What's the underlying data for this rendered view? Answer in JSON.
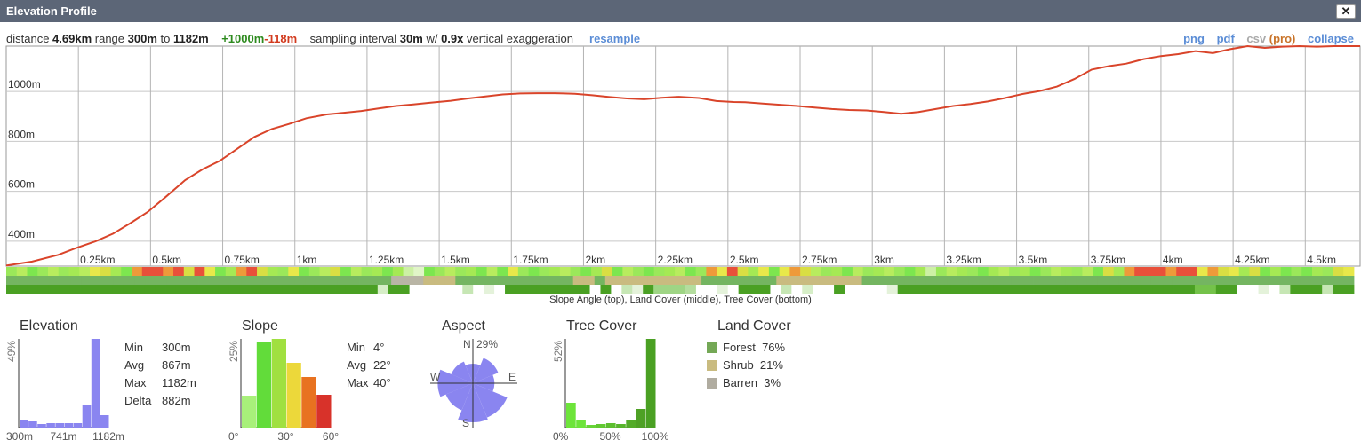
{
  "window": {
    "title": "Elevation Profile",
    "close_label": "✕"
  },
  "info": {
    "distance_label": "distance",
    "distance": "4.69km",
    "range_label": "range",
    "range_min": "300m",
    "to_label": "to",
    "range_max": "1182m",
    "gain": "+1000m",
    "loss": "-118m",
    "sampling_label": "sampling interval",
    "sampling": "30m",
    "w_label": "w/",
    "exaggeration": "0.9x",
    "exaggeration_label": "vertical exaggeration",
    "resample": "resample"
  },
  "toolbar": {
    "png": "png",
    "pdf": "pdf",
    "csv": "csv",
    "pro": "(pro)",
    "collapse": "collapse"
  },
  "chart_data": {
    "type": "line",
    "x_unit": "km",
    "y_unit": "m",
    "xlim": [
      0,
      4.69
    ],
    "ylim": [
      300,
      1182
    ],
    "y_ticks": [
      {
        "value": 400,
        "label": "400m"
      },
      {
        "value": 600,
        "label": "600m"
      },
      {
        "value": 800,
        "label": "800m"
      },
      {
        "value": 1000,
        "label": "1000m"
      }
    ],
    "x_ticks": [
      {
        "value": 0.25,
        "label": "0.25km"
      },
      {
        "value": 0.5,
        "label": "0.5km"
      },
      {
        "value": 0.75,
        "label": "0.75km"
      },
      {
        "value": 1.0,
        "label": "1km"
      },
      {
        "value": 1.25,
        "label": "1.25km"
      },
      {
        "value": 1.5,
        "label": "1.5km"
      },
      {
        "value": 1.75,
        "label": "1.75km"
      },
      {
        "value": 2.0,
        "label": "2km"
      },
      {
        "value": 2.25,
        "label": "2.25km"
      },
      {
        "value": 2.5,
        "label": "2.5km"
      },
      {
        "value": 2.75,
        "label": "2.75km"
      },
      {
        "value": 3.0,
        "label": "3km"
      },
      {
        "value": 3.25,
        "label": "3.25km"
      },
      {
        "value": 3.5,
        "label": "3.5km"
      },
      {
        "value": 3.75,
        "label": "3.75km"
      },
      {
        "value": 4.0,
        "label": "4km"
      },
      {
        "value": 4.25,
        "label": "4.25km"
      },
      {
        "value": 4.5,
        "label": "4.5km"
      }
    ],
    "series": [
      {
        "color": "#d9442a",
        "x": [
          0,
          0.09,
          0.18,
          0.24,
          0.31,
          0.37,
          0.43,
          0.49,
          0.55,
          0.62,
          0.68,
          0.74,
          0.8,
          0.86,
          0.92,
          0.98,
          1.04,
          1.11,
          1.17,
          1.23,
          1.29,
          1.35,
          1.41,
          1.47,
          1.54,
          1.6,
          1.66,
          1.72,
          1.78,
          1.84,
          1.9,
          1.97,
          2.03,
          2.09,
          2.15,
          2.21,
          2.27,
          2.33,
          2.4,
          2.46,
          2.52,
          2.56,
          2.62,
          2.68,
          2.74,
          2.8,
          2.86,
          2.92,
          2.98,
          3.04,
          3.1,
          3.16,
          3.22,
          3.28,
          3.34,
          3.4,
          3.46,
          3.52,
          3.58,
          3.64,
          3.7,
          3.76,
          3.82,
          3.88,
          3.94,
          4.0,
          4.06,
          4.12,
          4.18,
          4.24,
          4.3,
          4.36,
          4.42,
          4.48,
          4.54,
          4.6,
          4.69
        ],
        "y": [
          302,
          318,
          345,
          372,
          400,
          430,
          472,
          517,
          575,
          645,
          688,
          722,
          770,
          818,
          850,
          870,
          893,
          908,
          915,
          922,
          932,
          942,
          948,
          955,
          963,
          972,
          980,
          988,
          992,
          993,
          993,
          991,
          985,
          978,
          972,
          969,
          975,
          979,
          974,
          962,
          958,
          957,
          952,
          947,
          942,
          936,
          930,
          926,
          924,
          918,
          911,
          918,
          930,
          942,
          950,
          960,
          974,
          990,
          1002,
          1020,
          1050,
          1088,
          1102,
          1112,
          1130,
          1142,
          1150,
          1162,
          1154,
          1170,
          1182,
          1175,
          1180,
          1182,
          1180,
          1182,
          1182
        ]
      }
    ],
    "bands": [
      {
        "name": "Slope Angle",
        "colors": [
          "#9be85a",
          "#b8ec5e",
          "#7de64f",
          "#9be85a",
          "#b8ec5e",
          "#9be85a",
          "#a5e954",
          "#b8ec5e",
          "#e8e84a",
          "#d9de43",
          "#a5e954",
          "#7de64f",
          "#ee9a3a",
          "#e8503a",
          "#e8503a",
          "#ee9a3a",
          "#e8503a",
          "#d9de43",
          "#e8503a",
          "#e8e84a",
          "#7de64f",
          "#a5e954",
          "#ee9a3a",
          "#e8503a",
          "#d9de43",
          "#a5e954",
          "#9be85a",
          "#e8e84a",
          "#7de64f",
          "#9be85a",
          "#b8ec5e",
          "#d9de43",
          "#7de64f",
          "#b8ec5e",
          "#9be85a",
          "#a5e954",
          "#7de64f",
          "#a5e954",
          "#cdf0a5",
          "#e1f5c8",
          "#7de64f",
          "#9be85a",
          "#b8ec5e",
          "#9be85a",
          "#a5e954",
          "#7de64f",
          "#b8ec5e",
          "#7de64f",
          "#e8e84a",
          "#9be85a",
          "#7de64f",
          "#9be85a",
          "#a5e954",
          "#b8ec5e",
          "#9be85a",
          "#7de64f",
          "#a5e954",
          "#d9de43",
          "#7de64f",
          "#b8ec5e",
          "#9be85a",
          "#7de64f",
          "#9be85a",
          "#a5e954",
          "#b8ec5e",
          "#7de64f",
          "#9be85a",
          "#ee9a3a",
          "#e8e84a",
          "#e8503a",
          "#d9de43",
          "#a5e954",
          "#e8e84a",
          "#7de64f",
          "#e8e84a",
          "#ee9a3a",
          "#d9de43",
          "#b8ec5e",
          "#9be85a",
          "#a5e954",
          "#7de64f",
          "#b8ec5e",
          "#9be85a",
          "#a5e954",
          "#b8ec5e",
          "#9be85a",
          "#7de64f",
          "#a5e954",
          "#cdf0a5",
          "#9be85a",
          "#b8ec5e",
          "#a5e954",
          "#9be85a",
          "#7de64f",
          "#a5e954",
          "#b8ec5e",
          "#9be85a",
          "#a5e954",
          "#7de64f",
          "#9be85a",
          "#b8ec5e",
          "#a5e954",
          "#9be85a",
          "#b8ec5e",
          "#7de64f",
          "#d9de43",
          "#a5e954",
          "#ee9a3a",
          "#e8503a",
          "#e8503a",
          "#e8503a",
          "#ee9a3a",
          "#e8503a",
          "#e8503a",
          "#e8e84a",
          "#ee9a3a",
          "#d9de43",
          "#e8e84a",
          "#a5e954",
          "#d9de43",
          "#7de64f",
          "#a5e954",
          "#7de64f",
          "#9be85a",
          "#7de64f",
          "#a5e954",
          "#9be85a",
          "#d9de43",
          "#e8e84a"
        ]
      },
      {
        "name": "Land Cover",
        "colors": [
          "#74b561",
          "#74b561",
          "#74b561",
          "#74b561",
          "#74b561",
          "#74b561",
          "#74b561",
          "#74b561",
          "#74b561",
          "#74b561",
          "#74b561",
          "#74b561",
          "#74b561",
          "#74b561",
          "#74b561",
          "#74b561",
          "#74b561",
          "#74b561",
          "#74b561",
          "#74b561",
          "#74b561",
          "#74b561",
          "#74b561",
          "#74b561",
          "#74b561",
          "#74b561",
          "#74b561",
          "#74b561",
          "#74b561",
          "#74b561",
          "#74b561",
          "#74b561",
          "#74b561",
          "#74b561",
          "#74b561",
          "#74b561",
          "#b9b5a5",
          "#b9b5a5",
          "#b9b5a5",
          "#c9bb80",
          "#c9bb80",
          "#c9bb80",
          "#74b561",
          "#74b561",
          "#74b561",
          "#74b561",
          "#74b561",
          "#74b561",
          "#74b561",
          "#74b561",
          "#74b561",
          "#74b561",
          "#74b561",
          "#c9bb80",
          "#c9bb80",
          "#74b561",
          "#c9bb80",
          "#c9bb80",
          "#c9bb80",
          "#c9bb80",
          "#c9bb80",
          "#c9bb80",
          "#c9bb80",
          "#c9bb80",
          "#c9bb80",
          "#74b561",
          "#74b561",
          "#74b561",
          "#74b561",
          "#74b561",
          "#74b561",
          "#74b561",
          "#c9bb80",
          "#c9bb80",
          "#c9bb80",
          "#c9bb80",
          "#c9bb80",
          "#c9bb80",
          "#c9bb80",
          "#c9bb80",
          "#74b561",
          "#74b561",
          "#74b561",
          "#74b561",
          "#74b561",
          "#74b561",
          "#74b561",
          "#74b561",
          "#74b561",
          "#74b561",
          "#74b561",
          "#74b561",
          "#74b561",
          "#74b561",
          "#74b561",
          "#74b561",
          "#74b561",
          "#74b561",
          "#74b561",
          "#74b561",
          "#74b561",
          "#74b561",
          "#74b561",
          "#74b561",
          "#74b561",
          "#74b561",
          "#74b561",
          "#74b561",
          "#74b561",
          "#74b561",
          "#74b561",
          "#74b561",
          "#74b561",
          "#74b561",
          "#74b561",
          "#74b561",
          "#74b561",
          "#74b561",
          "#74b561",
          "#74b561",
          "#74b561",
          "#74b561",
          "#74b561",
          "#74b561",
          "#74b561",
          "#74b561"
        ]
      },
      {
        "name": "Tree Cover",
        "colors": [
          "#4aa023",
          "#4aa023",
          "#4aa023",
          "#4aa023",
          "#4aa023",
          "#4aa023",
          "#4aa023",
          "#4aa023",
          "#4aa023",
          "#4aa023",
          "#4aa023",
          "#4aa023",
          "#4aa023",
          "#4aa023",
          "#4aa023",
          "#4aa023",
          "#4aa023",
          "#4aa023",
          "#4aa023",
          "#4aa023",
          "#4aa023",
          "#4aa023",
          "#4aa023",
          "#4aa023",
          "#4aa023",
          "#4aa023",
          "#4aa023",
          "#4aa023",
          "#4aa023",
          "#4aa023",
          "#4aa023",
          "#4aa023",
          "#4aa023",
          "#4aa023",
          "#4aa023",
          "#d6eec7",
          "#4aa023",
          "#4aa023",
          "#ffffff",
          "#ffffff",
          "#ffffff",
          "#ffffff",
          "#ffffff",
          "#c6e6b4",
          "#ffffff",
          "#e4f2da",
          "#ffffff",
          "#4aa023",
          "#4aa023",
          "#4aa023",
          "#4aa023",
          "#4aa023",
          "#4aa023",
          "#4aa023",
          "#4aa023",
          "#ffffff",
          "#4aa023",
          "#ffffff",
          "#c6e6b4",
          "#e4f2da",
          "#4aa023",
          "#9fd585",
          "#9fd585",
          "#9fd585",
          "#b4dd9e",
          "#ffffff",
          "#ffffff",
          "#e4f2da",
          "#ffffff",
          "#4aa023",
          "#4aa023",
          "#4aa023",
          "#ffffff",
          "#c6e6b4",
          "#ffffff",
          "#d6eec7",
          "#ffffff",
          "#ffffff",
          "#4aa023",
          "#ffffff",
          "#ffffff",
          "#ffffff",
          "#ffffff",
          "#e4f2da",
          "#4aa023",
          "#4aa023",
          "#4aa023",
          "#4aa023",
          "#4aa023",
          "#4aa023",
          "#4aa023",
          "#4aa023",
          "#4aa023",
          "#4aa023",
          "#4aa023",
          "#4aa023",
          "#4aa023",
          "#4aa023",
          "#4aa023",
          "#4aa023",
          "#4aa023",
          "#4aa023",
          "#4aa023",
          "#4aa023",
          "#4aa023",
          "#4aa023",
          "#4aa023",
          "#4aa023",
          "#4aa023",
          "#4aa023",
          "#4aa023",
          "#4aa023",
          "#74c24a",
          "#74c24a",
          "#4aa023",
          "#4aa023",
          "#ffffff",
          "#ffffff",
          "#e4f2da",
          "#ffffff",
          "#c6e6b4",
          "#4aa023",
          "#4aa023",
          "#4aa023",
          "#c6e6b4",
          "#4aa023",
          "#4aa023"
        ]
      }
    ],
    "caption": "Slope Angle (top), Land Cover (middle), Tree Cover (bottom)"
  },
  "elevation_panel": {
    "title": "Elevation",
    "y_max_label": "49%",
    "x_labels": [
      "300m",
      "741m",
      "1182m"
    ],
    "bars": [
      9,
      7,
      4,
      5,
      5,
      5,
      5,
      25,
      100,
      14
    ],
    "bar_color": "#8a85f0",
    "stats": [
      {
        "label": "Min",
        "value": "300m"
      },
      {
        "label": "Avg",
        "value": "867m"
      },
      {
        "label": "Max",
        "value": "1182m"
      },
      {
        "label": "Delta",
        "value": "882m"
      }
    ]
  },
  "slope_panel": {
    "title": "Slope",
    "y_max_label": "25%",
    "x_labels": [
      "0°",
      "30°",
      "60°"
    ],
    "bars": [
      36,
      96,
      100,
      73,
      57,
      37
    ],
    "bar_colors": [
      "#a8f07a",
      "#62dc3a",
      "#a0e040",
      "#ecd83a",
      "#e87220",
      "#d8322a"
    ],
    "stats": [
      {
        "label": "Min",
        "value": "4°"
      },
      {
        "label": "Avg",
        "value": "22°"
      },
      {
        "label": "Max",
        "value": "40°"
      }
    ]
  },
  "aspect_panel": {
    "title": "Aspect",
    "n_label": "N",
    "n_value": "29%",
    "e_label": "E",
    "s_label": "S",
    "w_label": "W",
    "rose": [
      0.5,
      0.7,
      0.55,
      0.95,
      1.0,
      0.75,
      0.9,
      0.6
    ],
    "color": "#8a85f0"
  },
  "tree_panel": {
    "title": "Tree Cover",
    "y_max_label": "52%",
    "x_labels": [
      "0%",
      "50%",
      "100%"
    ],
    "bars": [
      28,
      8,
      3,
      4,
      5,
      4,
      8,
      21,
      100
    ],
    "bar_colors": [
      "#6de43a",
      "#6de43a",
      "#67d436",
      "#62c932",
      "#5dbf2f",
      "#58b52c",
      "#53ab28",
      "#4ea125",
      "#4aa023"
    ]
  },
  "land_cover": {
    "title": "Land Cover",
    "items": [
      {
        "label": "Forest",
        "value": "76%",
        "color": "#74a856"
      },
      {
        "label": "Shrub",
        "value": "21%",
        "color": "#c9bb80"
      },
      {
        "label": "Barren",
        "value": "3%",
        "color": "#b0aca0"
      }
    ]
  }
}
